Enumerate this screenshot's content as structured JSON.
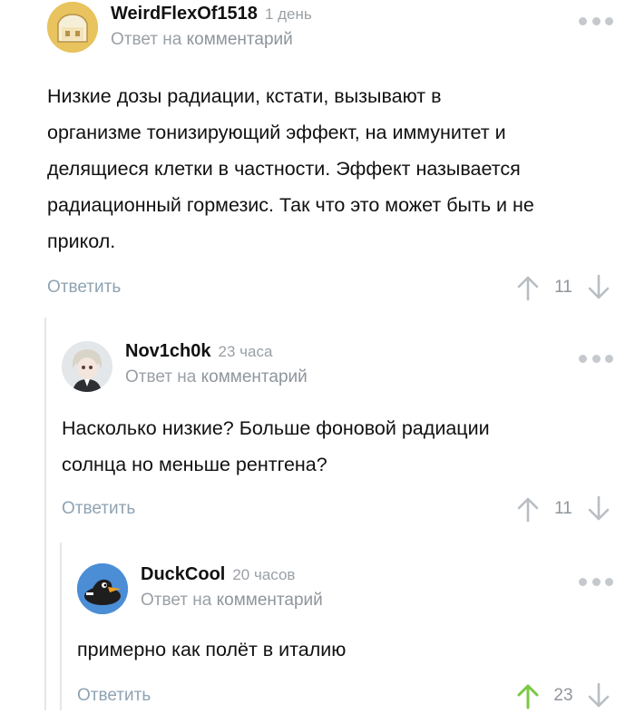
{
  "comments": [
    {
      "username": "WeirdFlexOf1518",
      "time": "1 день",
      "reply_prefix": "Ответ на",
      "reply_link": "комментарий",
      "text": "Низкие дозы радиации, кстати, вызывают в\nорганизме тонизирующий эффект, на иммунитет и\nделящиеся клетки в частности. Эффект называется\nрадиационный гормезис. Так что это может быть и не\nприкол.",
      "reply_label": "Ответить",
      "score": "11",
      "avatar_icon": "sandwich-avatar",
      "upvoted": false
    },
    {
      "username": "Nov1ch0k",
      "time": "23 часа",
      "reply_prefix": "Ответ на",
      "reply_link": "комментарий",
      "text": "Насколько низкие? Больше фоновой радиации\nсолнца но меньше рентгена?",
      "reply_label": "Ответить",
      "score": "11",
      "avatar_icon": "anime-character-avatar",
      "upvoted": false
    },
    {
      "username": "DuckCool",
      "time": "20 часов",
      "reply_prefix": "Ответ на",
      "reply_link": "комментарий",
      "text": "примерно как полёт в италию",
      "reply_label": "Ответить",
      "score": "23",
      "avatar_icon": "duck-avatar",
      "upvoted": true
    }
  ],
  "colors": {
    "upvote_active": "#7ac943",
    "vote_inactive": "#b9bec3",
    "reply_link": "#8fa3b2"
  }
}
